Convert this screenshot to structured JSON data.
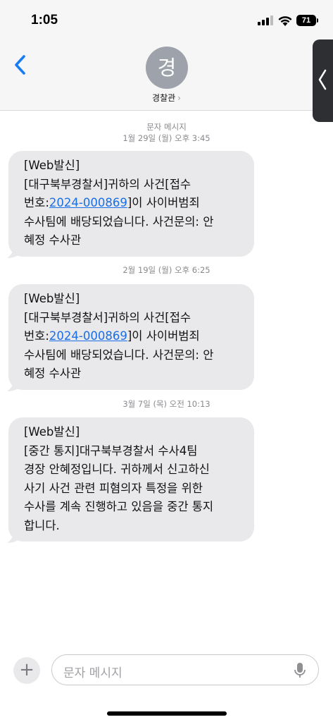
{
  "status_bar": {
    "time": "1:05",
    "battery_level": "71"
  },
  "header": {
    "avatar_letter": "경",
    "contact_name": "경찰관",
    "chevron": "›"
  },
  "thread": {
    "message_type_label": "문자 메시지",
    "messages": [
      {
        "timestamp": "1월 29일 (월) 오후 3:45",
        "text_before": "[Web발신]\n[대구북부경찰서]귀하의 사건[접수\n번호:",
        "link": "2024-000869",
        "text_after": "]이 사이버범죄\n수사팀에 배당되었습니다. 사건문의: 안\n혜정 수사관"
      },
      {
        "timestamp": "2월 19일 (월) 오후 6:25",
        "text_before": "[Web발신]\n[대구북부경찰서]귀하의 사건[접수\n번호:",
        "link": "2024-000869",
        "text_after": "]이 사이버범죄\n수사팀에 배당되었습니다. 사건문의: 안\n혜정 수사관"
      },
      {
        "timestamp": "3월 7일 (목) 오전 10:13",
        "text_before": "[Web발신]\n[중간 통지]대구북부경찰서 수사4팀\n경장 안혜정입니다. 귀하께서 신고하신\n사기 사건 관련 피혐의자 특정을 위한\n수사를 계속 진행하고 있음을 중간 통지\n합니다.",
        "link": "",
        "text_after": ""
      }
    ]
  },
  "composer": {
    "add_label": "+",
    "placeholder": "문자 메시지"
  },
  "colors": {
    "bubble": "#e9e9eb",
    "link": "#1a6ee6",
    "back_arrow": "#1a7cf5",
    "avatar": "#9ea2ab"
  },
  "icons": [
    "back-chevron-icon",
    "signal-icon",
    "wifi-icon",
    "battery-icon",
    "microphone-icon",
    "plus-icon",
    "side-panel-chevron-icon"
  ]
}
